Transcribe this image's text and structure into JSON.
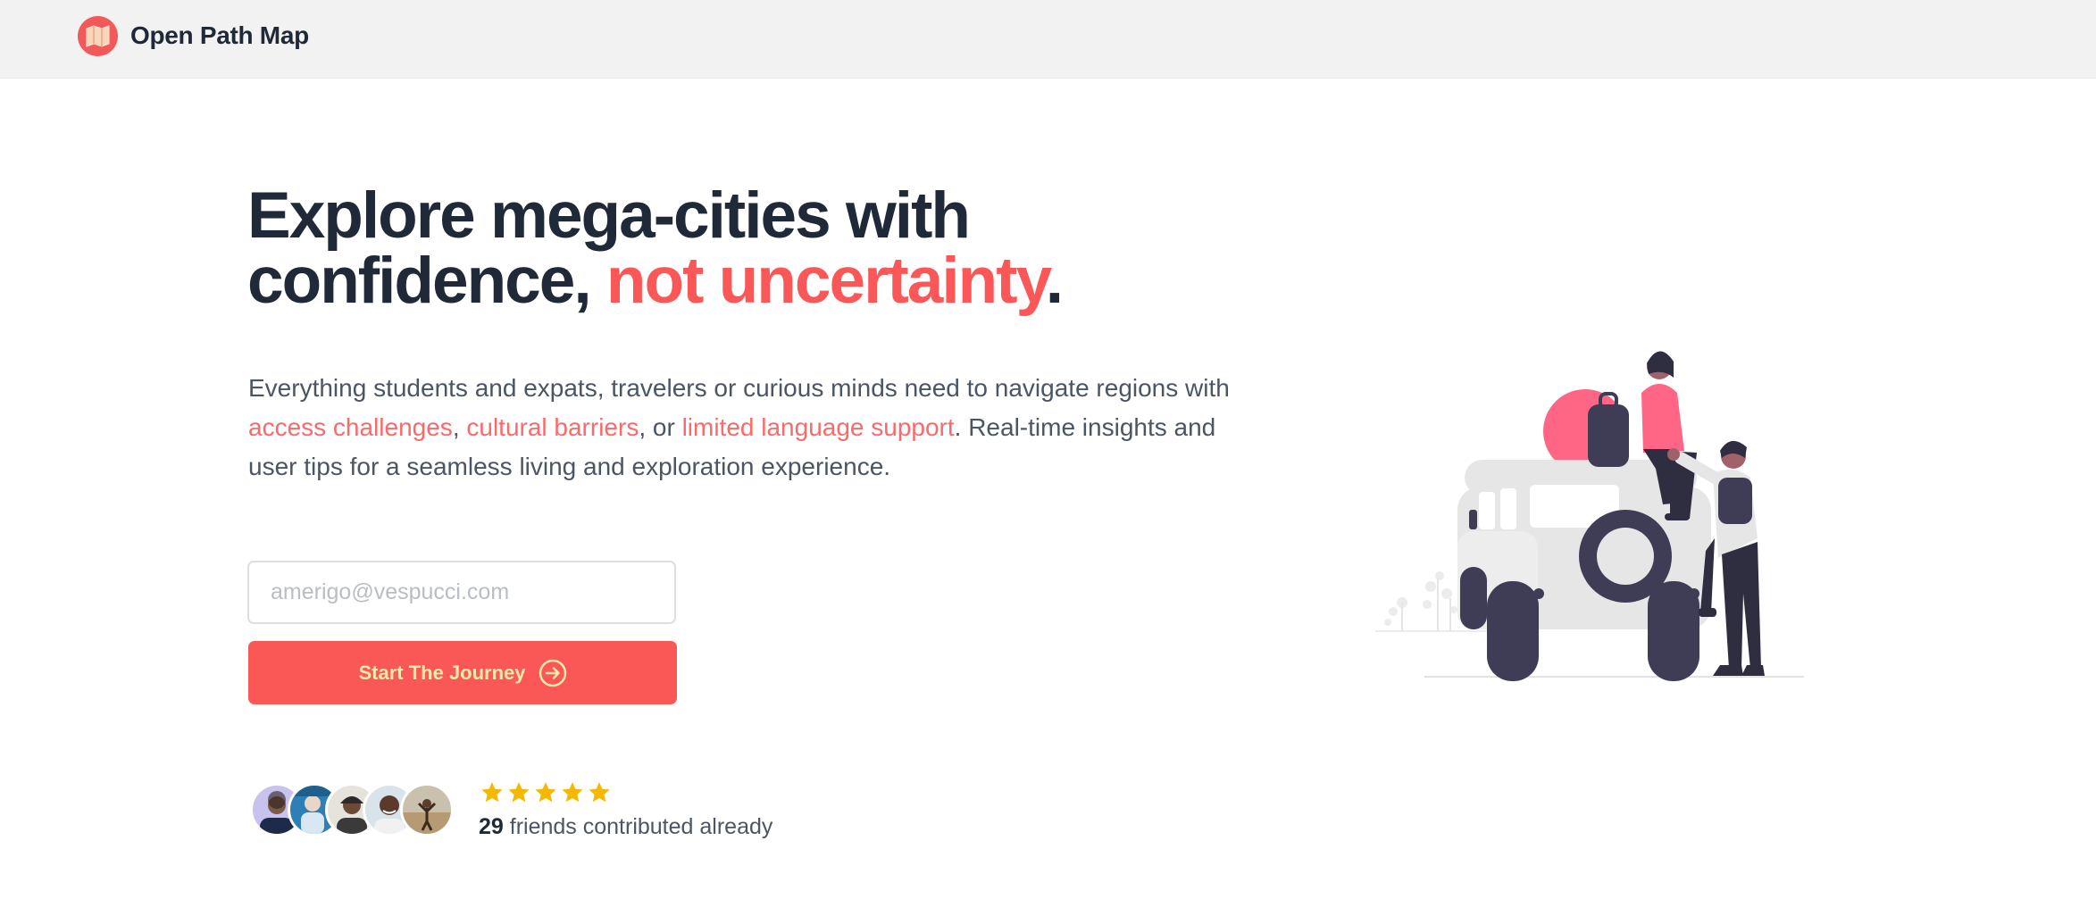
{
  "header": {
    "brand_name": "Open Path Map",
    "logo_icon": "map-icon"
  },
  "hero": {
    "headline_line1": "Explore mega-cities with",
    "headline_line2_plain": "confidence, ",
    "headline_line2_accent": "not uncertainty",
    "headline_period": ".",
    "description": {
      "part1": "Everything students and expats, travelers or curious minds need to navigate regions with ",
      "highlight1": "access challenges",
      "sep1": ", ",
      "highlight2": "cultural barriers",
      "sep2": ", or ",
      "highlight3": "limited language support",
      "part2": ". Real-time insights and user tips for a seamless living and exploration experience."
    }
  },
  "signup": {
    "email_placeholder": "amerigo@vespucci.com",
    "email_value": "",
    "cta_label": "Start The Journey",
    "cta_icon": "arrow-right-circle-icon"
  },
  "social_proof": {
    "rating": 5,
    "contributor_count": "29",
    "contributor_text": " friends contributed already",
    "avatar_count": 5
  },
  "colors": {
    "accent": "#fa5858",
    "text_dark": "#1f2937",
    "text_muted": "#4b5563",
    "star": "#f5b800",
    "topbar_bg": "#f2f2f2"
  },
  "illustration": "two-travelers-with-jeep-illustration"
}
